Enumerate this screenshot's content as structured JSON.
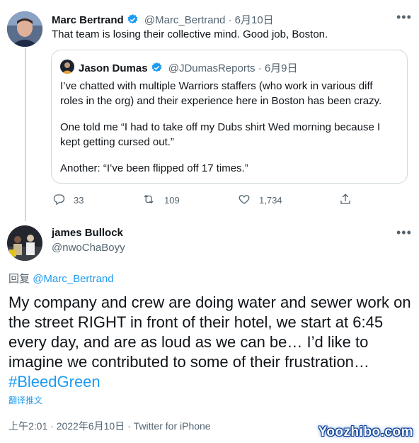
{
  "parent_tweet": {
    "author_name": "Marc Bertrand",
    "author_handle": "@Marc_Bertrand",
    "separator": "·",
    "date": "6月10日",
    "text": "That team is losing their collective mind. Good job, Boston.",
    "more_label": "•••",
    "quoted": {
      "author_name": "Jason Dumas",
      "author_handle": "@JDumasReports",
      "separator": "·",
      "date": "6月9日",
      "para1": "I’ve chatted with multiple Warriors staffers (who work in various diff roles in the org) and their experience here in Boston has been crazy.",
      "para2": "One told me “I had to take off my Dubs shirt Wed morning because I kept getting cursed out.”",
      "para3": "Another: “I’ve been flipped off 17 times.”"
    },
    "actions": {
      "reply_count": "33",
      "retweet_count": "109",
      "like_count": "1,734"
    }
  },
  "main_tweet": {
    "author_name": "james Bullock",
    "author_handle": "@nwoChaBoyy",
    "more_label": "•••",
    "reply_prefix": "回复",
    "reply_to": "@Marc_Bertrand",
    "text": "My company and crew are doing water and sewer work on the street RIGHT in front of their hotel, we start at 6:45 every day, and are as loud as we can be… I’d like to imagine we contributed to some of their frustration…",
    "hashtag": "#BleedGreen",
    "translate_label": "翻译推文",
    "timestamp": "上午2:01 · 2022年6月10日",
    "separator": "·",
    "source": "Twitter for iPhone"
  },
  "watermark": "Yoozhibo.com",
  "colors": {
    "accent": "#1d9bf0",
    "muted": "#536471",
    "border": "#cfd9de",
    "text": "#0f1419"
  },
  "icons": [
    "verified-badge-icon",
    "more-icon",
    "reply-icon",
    "retweet-icon",
    "like-icon",
    "share-icon"
  ]
}
